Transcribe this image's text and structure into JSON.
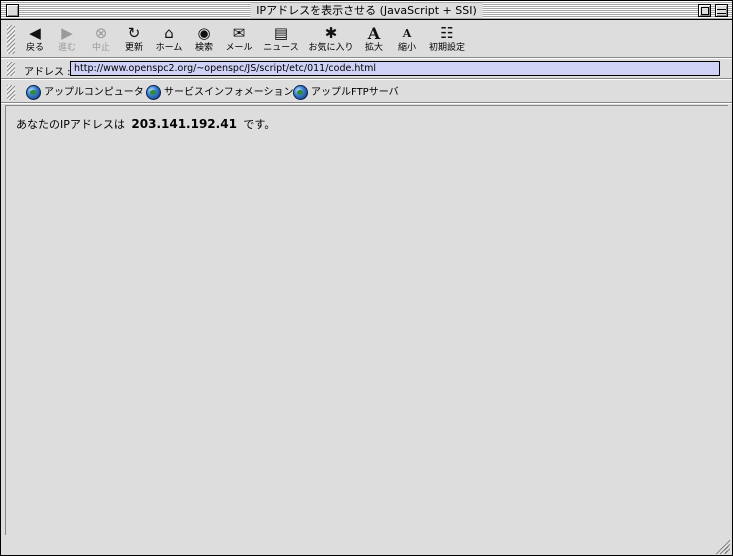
{
  "window": {
    "title": "IPアドレスを表示させる (JavaScript + SSI)"
  },
  "toolbar": {
    "items": [
      {
        "label": "戻る",
        "icon": "back-icon",
        "glyph": "◀",
        "enabled": true
      },
      {
        "label": "進む",
        "icon": "forward-icon",
        "glyph": "▶",
        "enabled": false
      },
      {
        "label": "中止",
        "icon": "stop-icon",
        "glyph": "⊗",
        "enabled": false
      },
      {
        "label": "更新",
        "icon": "refresh-icon",
        "glyph": "↻",
        "enabled": true
      },
      {
        "label": "ホーム",
        "icon": "home-icon",
        "glyph": "⌂",
        "enabled": true
      },
      {
        "label": "検索",
        "icon": "search-icon",
        "glyph": "◉",
        "enabled": true
      },
      {
        "label": "メール",
        "icon": "mail-icon",
        "glyph": "✉",
        "enabled": true
      },
      {
        "label": "ニュース",
        "icon": "news-icon",
        "glyph": "▤",
        "enabled": true
      },
      {
        "label": "お気に入り",
        "icon": "favorites-icon",
        "glyph": "✱",
        "enabled": true
      },
      {
        "label": "拡大",
        "icon": "text-larger-icon",
        "glyph": "A",
        "enabled": true
      },
      {
        "label": "縮小",
        "icon": "text-smaller-icon",
        "glyph": "A",
        "enabled": true
      },
      {
        "label": "初期設定",
        "icon": "preferences-icon",
        "glyph": "☷",
        "enabled": true
      }
    ]
  },
  "address": {
    "label": "アドレス :",
    "value": "http://www.openspc2.org/~openspc/JS/script/etc/011/code.html"
  },
  "favorites": {
    "items": [
      {
        "label": "アップルコンピュータ",
        "icon": "globe-icon"
      },
      {
        "label": "サービスインフォメーション",
        "icon": "globe-icon"
      },
      {
        "label": "アップルFTPサーバ",
        "icon": "globe-icon"
      }
    ]
  },
  "content": {
    "prefix": "あなたのIPアドレスは",
    "ip": "203.141.192.41",
    "suffix": "です。"
  },
  "colors": {
    "chrome": "#dddddd",
    "address_highlight": "#cfd2f5"
  }
}
